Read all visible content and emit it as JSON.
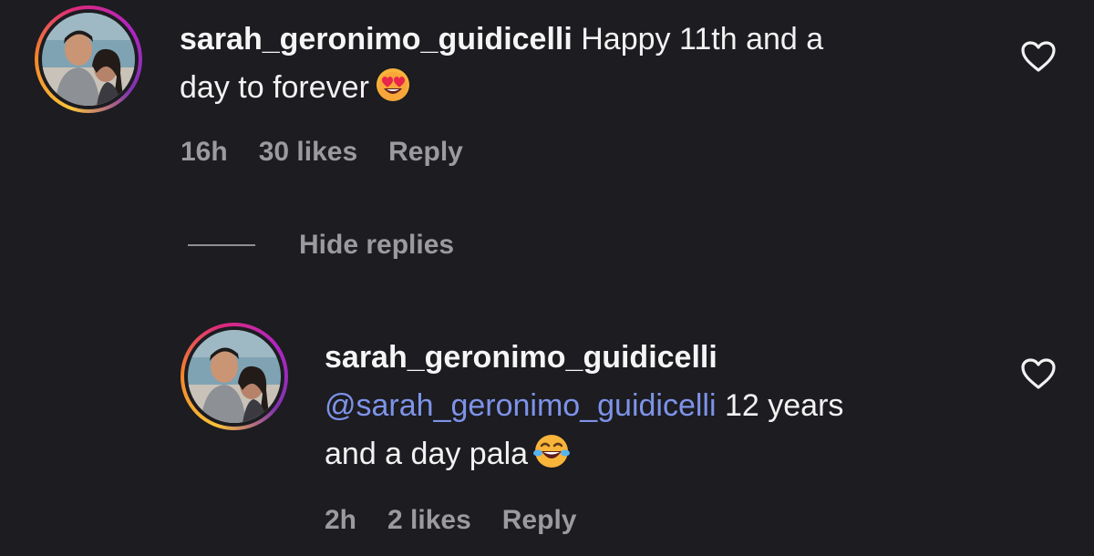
{
  "comments": [
    {
      "username": "sarah_geronimo_guidicelli",
      "text_line1": "Happy 11th and a",
      "text_line2": "day to forever",
      "emoji": "heart-eyes-emoji",
      "time": "16h",
      "likes": "30 likes",
      "reply_label": "Reply"
    }
  ],
  "hide_replies_label": "Hide replies",
  "replies": [
    {
      "username": "sarah_geronimo_guidicelli",
      "mention": "@sarah_geronimo_guidicelli",
      "text_line1_rest": " 12 years",
      "text_line2": "and a day pala",
      "emoji": "laughing-tears-emoji",
      "time": "2h",
      "likes": "2 likes",
      "reply_label": "Reply"
    }
  ],
  "icons": {
    "like": "heart-outline-icon",
    "avatar": "profile-photo"
  },
  "colors": {
    "background": "#1c1c21",
    "text": "#f2f2f2",
    "meta": "#9a9a9f",
    "mention": "#7e93e8",
    "story_ring_start": "#f9c33a",
    "story_ring_end": "#b025c4"
  }
}
